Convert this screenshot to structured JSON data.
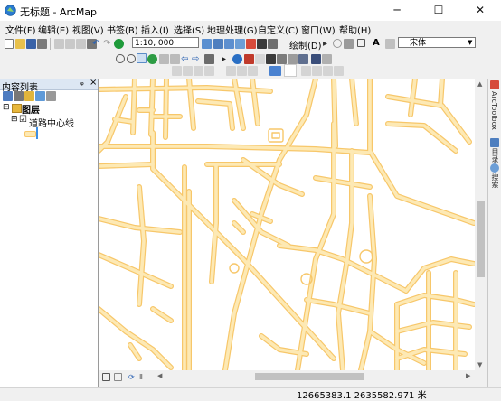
{
  "window": {
    "title": "无标题 - ArcMap",
    "minimize": "─",
    "maximize": "☐",
    "close": "✕"
  },
  "menu": [
    "文件(F)",
    "编辑(E)",
    "视图(V)",
    "书签(B)",
    "插入(I)",
    "选择(S)",
    "地理处理(G)",
    "自定义(C)",
    "窗口(W)",
    "帮助(H)"
  ],
  "toolbar": {
    "scale_value": "1:10, 000",
    "draw_label": "绘制(D)",
    "font_value": "宋体",
    "text_tool": "A"
  },
  "toc": {
    "title": "内容列表",
    "pin": "ᵩ",
    "close": "×",
    "layers_root": "图层",
    "layer_name": "道路中心线",
    "expand_root": "⊟",
    "expand_layer": "⊟",
    "checkbox": "☑"
  },
  "dock": {
    "arctoolbox": "ArcToolbox",
    "catalog": "目录",
    "search": "搜索"
  },
  "status": {
    "coordinates": "12665383.1  2635582.971 米"
  },
  "colors": {
    "road_fill": "#fde9b4",
    "road_edge": "#f7c76a",
    "selection_accent": "#3d8fe6"
  }
}
